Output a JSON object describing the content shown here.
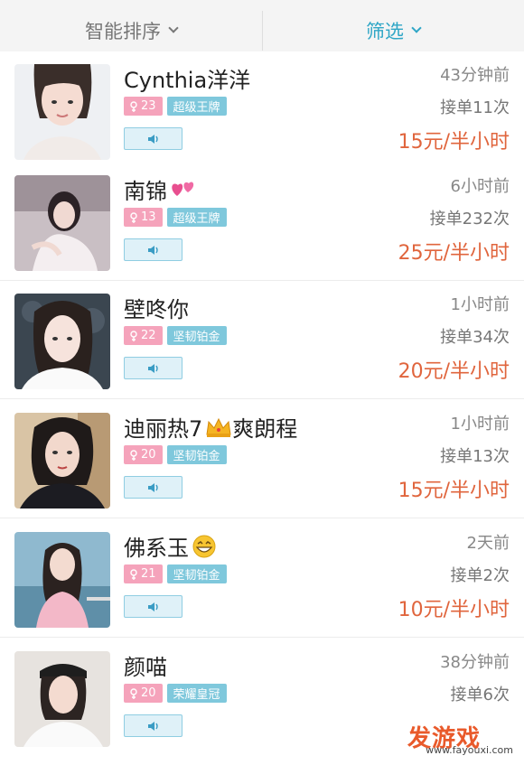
{
  "header": {
    "sort_label": "智能排序",
    "filter_label": "筛选"
  },
  "colors": {
    "accent": "#2fa6c6",
    "price": "#e0653d",
    "age_badge": "#f5a3bb",
    "level_badge": "#7fc8dc"
  },
  "players": [
    {
      "name": "Cynthia洋洋",
      "age": "23",
      "level": "超级王牌",
      "time": "43分钟前",
      "orders": "接单11次",
      "price": "15元/半小时",
      "emoji": ""
    },
    {
      "name": "南锦",
      "age": "13",
      "level": "超级王牌",
      "time": "6小时前",
      "orders": "接单232次",
      "price": "25元/半小时",
      "emoji": "two-hearts"
    },
    {
      "name": "壁咚你",
      "age": "22",
      "level": "坚韧铂金",
      "time": "1小时前",
      "orders": "接单34次",
      "price": "20元/半小时",
      "emoji": ""
    },
    {
      "name": "迪丽热7",
      "name_suffix": "爽朗程",
      "age": "20",
      "level": "坚韧铂金",
      "time": "1小时前",
      "orders": "接单13次",
      "price": "15元/半小时",
      "emoji": "crown"
    },
    {
      "name": "佛系玉",
      "age": "21",
      "level": "坚韧铂金",
      "time": "2天前",
      "orders": "接单2次",
      "price": "10元/半小时",
      "emoji": "grin"
    },
    {
      "name": "颜喵",
      "age": "20",
      "level": "荣耀皇冠",
      "time": "38分钟前",
      "orders": "接单6次",
      "price": "",
      "emoji": ""
    }
  ],
  "watermark": {
    "brand": "发游戏",
    "url": "www.fayouxi.com"
  }
}
